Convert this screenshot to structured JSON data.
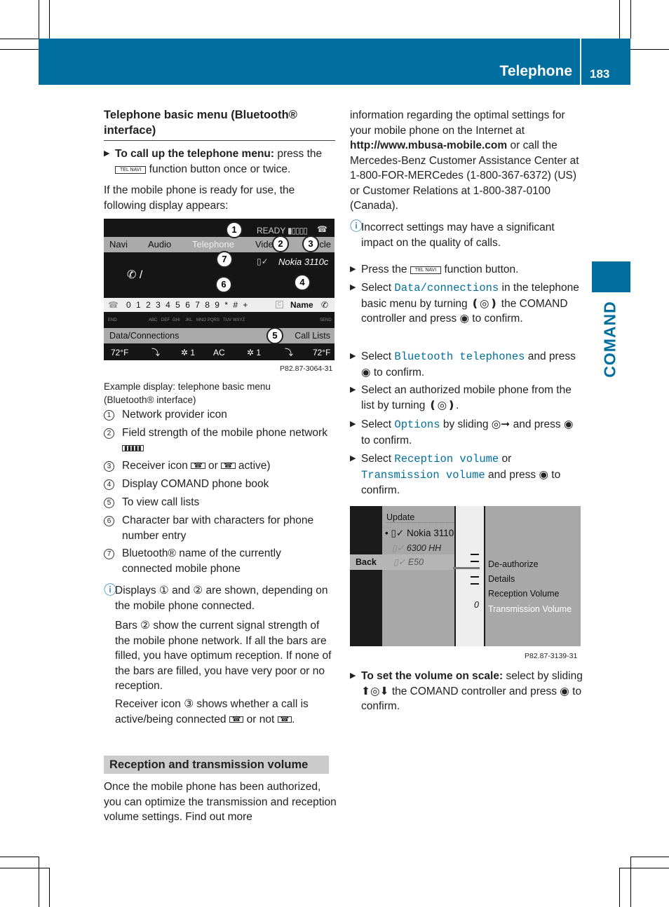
{
  "header": {
    "section": "Telephone",
    "page": "183",
    "side_tab": "COMAND",
    "color": "#006e9e"
  },
  "left": {
    "title": "Telephone basic menu (Bluetooth® interface)",
    "step1_bold": "To call up the telephone menu:",
    "step1_rest": "press the",
    "step1_rest2": "function button once or twice.",
    "tel_key": "TEL NAVI",
    "intro": "If the mobile phone is ready for use, the following display appears:",
    "screen": {
      "status": "READY",
      "tabs": [
        "Navi",
        "Audio",
        "Telephone",
        "Video",
        "Vehicle"
      ],
      "phone_name": "Nokia 3110c",
      "chars": [
        "0",
        "1",
        "2",
        "3",
        "4",
        "5",
        "6",
        "7",
        "8",
        "9",
        "*",
        "#",
        "+"
      ],
      "letters": [
        "END",
        "ABC",
        "DEF",
        "GHI",
        "JKL",
        "MNO",
        "PQRS",
        "TUV",
        "WXYZ",
        "SEND"
      ],
      "name": "Name",
      "clear": "C",
      "bottom_left": "Data/Connections",
      "bottom_right": "Call Lists",
      "climate": [
        "72°F",
        "1",
        "AC",
        "1",
        "72°F"
      ],
      "ref": "P82.87-3064-31"
    },
    "caption": "Example display: telephone basic menu (Bluetooth® interface)",
    "legend": [
      {
        "n": "1",
        "text": "Network provider icon"
      },
      {
        "n": "2",
        "text": "Field strength of the mobile phone network"
      },
      {
        "n": "3",
        "text": "Receiver icon",
        "mid": "or",
        "end": "active)"
      },
      {
        "n": "4",
        "text": "Display COMAND phone book"
      },
      {
        "n": "5",
        "text": "To view call lists"
      },
      {
        "n": "6",
        "text": "Character bar with characters for phone number entry"
      },
      {
        "n": "7",
        "text": "Bluetooth® name of the currently connected mobile phone"
      }
    ],
    "info1": "Displays ① and ② are shown, depending on the mobile phone connected.",
    "info2": "Bars ② show the current signal strength of the mobile phone network. If all the bars are filled, you have optimum reception. If none of the bars are filled, you have very poor or no reception.",
    "info3": "Receiver icon ③ shows whether a call is active/being connected",
    "info3_mid": "or not",
    "section2": "Reception and transmission volume",
    "section2_text": "Once the mobile phone has been authorized, you can optimize the transmission and reception volume settings. Find out more"
  },
  "right": {
    "cont": "information regarding the optimal settings for your mobile phone on the Internet at",
    "url": "http://www.mbusa-mobile.com",
    "cont2": "or call the Mercedes-Benz Customer Assistance Center at 1-800-FOR-MERCedes (1-800-367-6372) (US) or Customer Relations at 1-800-387-0100 (Canada).",
    "info": "Incorrect settings may have a significant impact on the quality of calls.",
    "steps": [
      {
        "a": "Press the",
        "b": "function button."
      },
      {
        "a": "Select",
        "m": "Data/connections",
        "b": "in the telephone basic menu by turning",
        "c": "the COMAND controller and press",
        "d": "to confirm."
      },
      {
        "a": "Select",
        "m": "Bluetooth telephones",
        "b": "and press",
        "c": "to confirm."
      },
      {
        "a": "Select an authorized mobile phone from the list by turning"
      },
      {
        "a": "Select",
        "m": "Options",
        "b": "by sliding",
        "c": "and press",
        "d": "to confirm."
      },
      {
        "a": "Select",
        "m": "Reception volume",
        "b": "or",
        "m2": "Transmission volume",
        "c": "and press",
        "d": "to confirm."
      }
    ],
    "screen2": {
      "update": "Update",
      "phones": [
        "Nokia 3110",
        "6300 HH",
        "E50"
      ],
      "back": "Back",
      "menu": [
        "De-authorize",
        "Details",
        "Reception Volume",
        "Transmission Volume"
      ],
      "scale_value": "0",
      "ref": "P82.87-3139-31"
    },
    "last_bold": "To set the volume on scale:",
    "last_rest": "select by sliding",
    "last_rest2": "the COMAND controller and press",
    "last_rest3": "to confirm."
  }
}
